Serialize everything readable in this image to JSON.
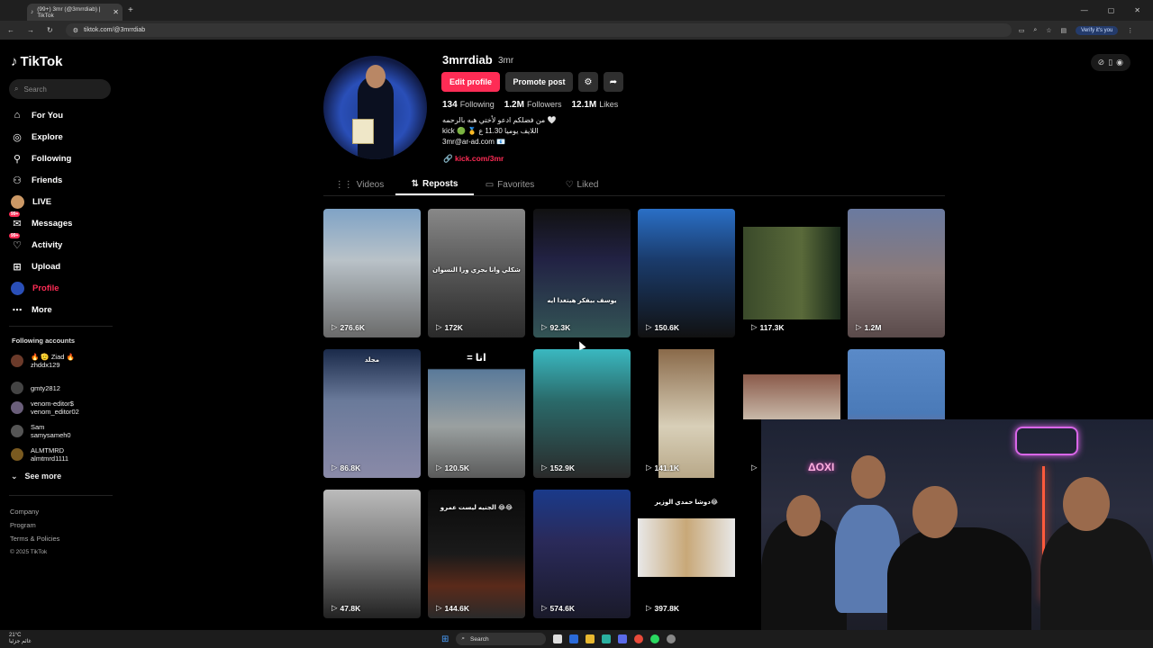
{
  "browser": {
    "tab_title": "(99+) 3mr (@3mrrdiab) | TikTok",
    "url": "tiktok.com/@3mrrdiab",
    "verify_label": "Verify it's you"
  },
  "sidebar": {
    "logo": "TikTok",
    "search_placeholder": "Search",
    "items": [
      {
        "label": "For You",
        "icon": "home-icon"
      },
      {
        "label": "Explore",
        "icon": "compass-icon"
      },
      {
        "label": "Following",
        "icon": "following-icon"
      },
      {
        "label": "Friends",
        "icon": "friends-icon"
      },
      {
        "label": "LIVE",
        "icon": "live-icon"
      },
      {
        "label": "Messages",
        "icon": "messages-icon",
        "badge": "99+"
      },
      {
        "label": "Activity",
        "icon": "activity-icon",
        "badge": "99+"
      },
      {
        "label": "Upload",
        "icon": "upload-icon"
      },
      {
        "label": "Profile",
        "icon": "profile-icon"
      },
      {
        "label": "More",
        "icon": "more-icon"
      }
    ],
    "following_title": "Following accounts",
    "following": [
      {
        "line1": "🔥 🫡 Ziad 🔥",
        "line2": "zhddx129"
      },
      {
        "line1": "gmty2812",
        "line2": ""
      },
      {
        "line1": "venom-editor$",
        "line2": "venom_editor02"
      },
      {
        "line1": "Sam",
        "line2": "samysameh0"
      },
      {
        "line1": "ALMTMRD",
        "line2": "almtmrd1111"
      }
    ],
    "see_more": "See more",
    "footer": [
      "Company",
      "Program",
      "Terms & Policies",
      "© 2025 TikTok"
    ]
  },
  "profile": {
    "username": "3mrrdiab",
    "nickname": "3mr",
    "edit_button": "Edit profile",
    "promote_button": "Promote post",
    "following_count": "134",
    "following_label": "Following",
    "followers_count": "1.2M",
    "followers_label": "Followers",
    "likes_count": "12.1M",
    "likes_label": "Likes",
    "bio_line1": "من فضلكم ادعو لأختي هبه بالرحمه 🤍",
    "bio_line2": "kick 🟢 🥇 اللايف يوميا 11.30 ع",
    "bio_line3": "3mr@ar-ad.com 📧",
    "link": "kick.com/3mr"
  },
  "tabs": [
    "Videos",
    "Reposts",
    "Favorites",
    "Liked"
  ],
  "videos": [
    {
      "views": "276.6K",
      "caption": ""
    },
    {
      "views": "172K",
      "caption": "شكلي وانا بجري ورا النسوان"
    },
    {
      "views": "92.3K",
      "caption": "يوسف بيفكر هيتغدا ايه"
    },
    {
      "views": "150.6K",
      "caption": ""
    },
    {
      "views": "117.3K",
      "caption": ""
    },
    {
      "views": "1.2M",
      "caption": ""
    },
    {
      "views": "86.8K",
      "caption": "مجلد"
    },
    {
      "views": "120.5K",
      "caption": "= انا"
    },
    {
      "views": "152.9K",
      "caption": ""
    },
    {
      "views": "141.1K",
      "caption": ""
    },
    {
      "views": "",
      "caption": ""
    },
    {
      "views": "",
      "caption": ""
    },
    {
      "views": "47.8K",
      "caption": ""
    },
    {
      "views": "144.6K",
      "caption": "الجنيه ليست عمرو 😂😂"
    },
    {
      "views": "574.6K",
      "caption": ""
    },
    {
      "views": "397.8K",
      "caption": "دوشا حمدي الوزير😂"
    }
  ],
  "taskbar": {
    "temp": "21°C",
    "weather": "غائم جزئيا",
    "search": "Search"
  },
  "pip": {
    "sign": "ΔOXI"
  }
}
